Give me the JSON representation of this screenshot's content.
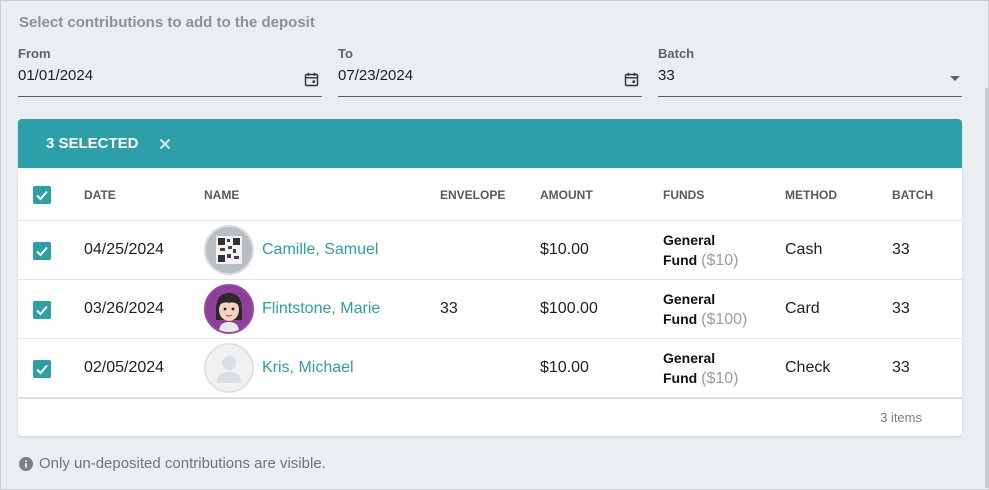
{
  "heading": "Select contributions to add to the deposit",
  "filters": {
    "from_label": "From",
    "from_value": "01/01/2024",
    "to_label": "To",
    "to_value": "07/23/2024",
    "batch_label": "Batch",
    "batch_value": "33"
  },
  "selection": {
    "text": "3 SELECTED"
  },
  "table": {
    "columns": [
      "DATE",
      "NAME",
      "ENVELOPE",
      "AMOUNT",
      "FUNDS",
      "METHOD",
      "BATCH"
    ],
    "rows": [
      {
        "date": "04/25/2024",
        "name": "Camille, Samuel",
        "envelope": "",
        "amount": "$10.00",
        "fund_name_1": "General",
        "fund_name_2": "Fund",
        "fund_amount": "($10)",
        "method": "Cash",
        "batch": "33",
        "avatar": "qr-code-avatar"
      },
      {
        "date": "03/26/2024",
        "name": "Flintstone, Marie",
        "envelope": "33",
        "amount": "$100.00",
        "fund_name_1": "General",
        "fund_name_2": "Fund",
        "fund_amount": "($100)",
        "method": "Card",
        "batch": "33",
        "avatar": "cartoon-girl-avatar"
      },
      {
        "date": "02/05/2024",
        "name": "Kris, Michael",
        "envelope": "",
        "amount": "$10.00",
        "fund_name_1": "General",
        "fund_name_2": "Fund",
        "fund_amount": "($10)",
        "method": "Check",
        "batch": "33",
        "avatar": "placeholder-person-avatar"
      }
    ],
    "footer_count": "3 items"
  },
  "note": "Only un-deposited contributions are visible.",
  "colors": {
    "accent": "#2c9fa9",
    "background": "#ebeef0"
  }
}
